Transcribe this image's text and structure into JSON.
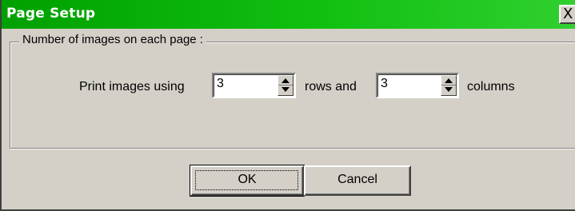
{
  "window": {
    "title": "Page Setup",
    "close_glyph": "X"
  },
  "group": {
    "label": "Number of images on each page :"
  },
  "layout_row": {
    "prefix": "Print images using",
    "rows_value": "3",
    "middle": "rows and",
    "columns_value": "3",
    "suffix": "columns"
  },
  "buttons": {
    "ok": "OK",
    "cancel": "Cancel"
  },
  "colors": {
    "titlebar": "#10c010",
    "dialog_bg": "#d4d0c8"
  },
  "icons": {
    "close": "close-icon",
    "spin_up": "arrow-up-icon",
    "spin_down": "arrow-down-icon"
  }
}
